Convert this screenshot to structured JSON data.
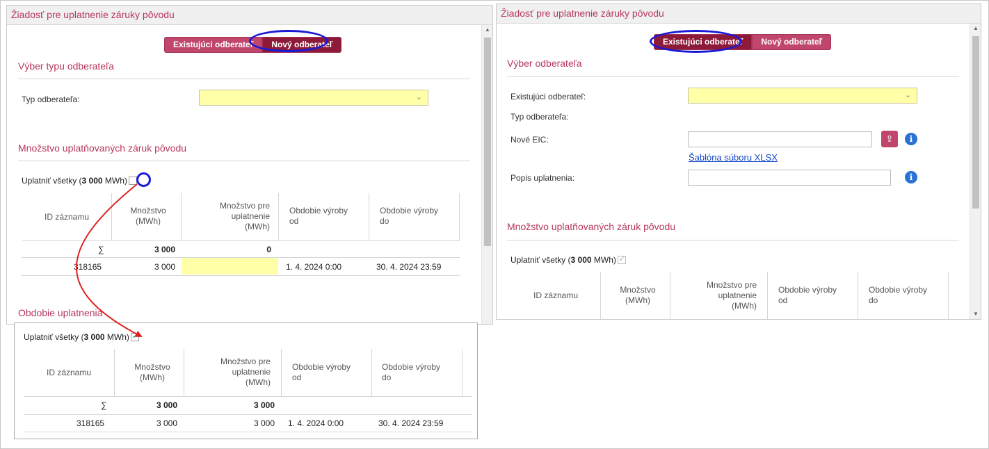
{
  "left_panel": {
    "title": "Žiadosť pre uplatnenie záruky pôvodu",
    "toggle": {
      "existing": "Existujúci odberateľ",
      "new": "Nový odberateľ"
    },
    "section_type": "Výber typu odberateľa",
    "type_label": "Typ odberateľa:",
    "section_quantity": "Množstvo uplatňovaných záruk pôvodu",
    "apply_all_prefix": "Uplatniť všetky (",
    "apply_all_amount": "3 000",
    "apply_all_suffix": " MWh)",
    "columns": [
      "ID záznamu",
      "Množstvo\n(MWh)",
      "Množstvo pre\nuplatnenie\n(MWh)",
      "Obdobie výroby\nod",
      "Obdobie výroby\ndo"
    ],
    "sum_row": {
      "symbol": "∑",
      "quantity": "3 000",
      "apply": "0"
    },
    "rows": [
      {
        "id": "318165",
        "quantity": "3 000",
        "apply": "",
        "from": "1. 4. 2024 0:00",
        "to": "30. 4. 2024 23:59"
      }
    ],
    "section_period": "Obdobie uplatnenia"
  },
  "zoom_panel": {
    "apply_all_prefix": "Uplatniť všetky (",
    "apply_all_amount": "3 000",
    "apply_all_suffix": " MWh)",
    "columns": [
      "ID záznamu",
      "Množstvo\n(MWh)",
      "Množstvo pre\nuplatnenie\n(MWh)",
      "Obdobie výroby\nod",
      "Obdobie výroby\ndo"
    ],
    "sum_row": {
      "symbol": "∑",
      "quantity": "3 000",
      "apply": "3 000"
    },
    "rows": [
      {
        "id": "318165",
        "quantity": "3 000",
        "apply": "3 000",
        "from": "1. 4. 2024 0:00",
        "to": "30. 4. 2024 23:59"
      }
    ]
  },
  "right_panel": {
    "title": "Žiadosť pre uplatnenie záruky pôvodu",
    "toggle": {
      "existing": "Existujúci odberateľ",
      "new": "Nový odberateľ"
    },
    "section_select": "Výber odberateľa",
    "existing_label": "Existujúci odberateľ:",
    "type_label": "Typ odberateľa:",
    "eic_label": "Nové EIC:",
    "template_link": "Šablóna súboru XLSX",
    "description_label": "Popis uplatnenia:",
    "section_quantity": "Množstvo uplatňovaných záruk pôvodu",
    "apply_all_prefix": "Uplatniť všetky (",
    "apply_all_amount": "3 000",
    "apply_all_suffix": " MWh)",
    "columns": [
      "ID záznamu",
      "Množstvo\n(MWh)",
      "Množstvo pre\nuplatnenie\n(MWh)",
      "Obdobie výroby\nod",
      "Obdobie výroby\ndo"
    ]
  },
  "icons": {
    "upload": "upload-icon",
    "info": "info-icon",
    "dropdown": "chevron-down-icon",
    "scroll_up": "scroll-up-icon",
    "scroll_down": "scroll-down-icon"
  },
  "colors": {
    "accent": "#b7375c",
    "button": "#c0476b",
    "button_active": "#8e1a3a",
    "input_required": "#ffffa8",
    "highlight_ring": "#1a1ad6",
    "arrow": "#e02020",
    "link": "#1246c6"
  }
}
